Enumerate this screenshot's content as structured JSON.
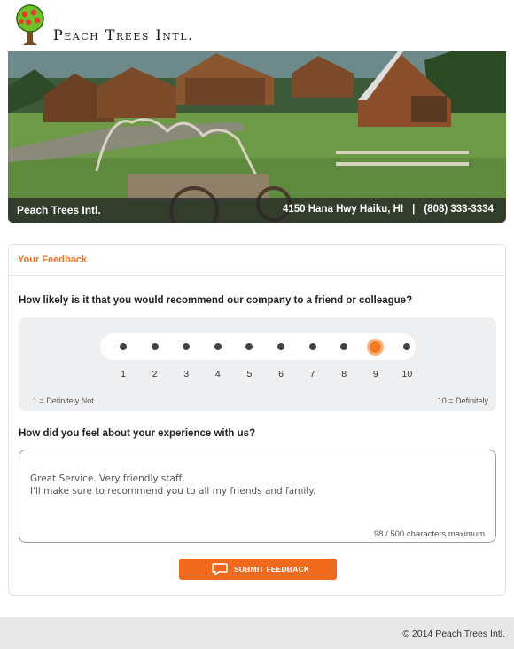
{
  "brand": {
    "name": "Peach Trees Intl.",
    "logo_icon": "peach-tree-logo-icon"
  },
  "hero": {
    "business_name": "Peach Trees Intl.",
    "address": "4150 Hana Hwy Haiku, HI",
    "separator": "|",
    "phone": "(808) 333-3334"
  },
  "feedback": {
    "section_title": "Your Feedback",
    "question_recommend": "How likely is it that you would recommend our company to a friend or colleague?",
    "scale": [
      "1",
      "2",
      "3",
      "4",
      "5",
      "6",
      "7",
      "8",
      "9",
      "10"
    ],
    "selected": 9,
    "label_low": "1 = Definitely Not",
    "label_high": "10 = Definitely",
    "question_experience": "How did you feel about your experience with us?",
    "comment": "Great Service. Very friendly staff.\nI'll make sure to recommend you to all my friends and family.",
    "char_counter": "98 / 500 characters maximum",
    "submit_label": "SUBMIT FEEDBACK",
    "submit_icon": "chat-bubble-icon"
  },
  "colors": {
    "accent": "#f06a1d",
    "selected_dot": "#f27b26"
  },
  "footer": {
    "copyright": "© 2014 Peach Trees Intl."
  }
}
